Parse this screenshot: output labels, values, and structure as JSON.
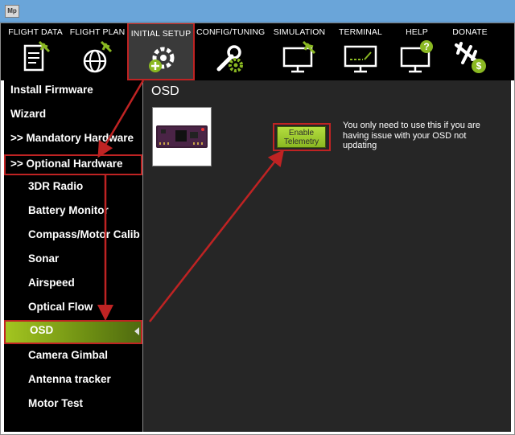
{
  "window": {
    "logo_text": "Mp"
  },
  "menu": [
    {
      "label": "FLIGHT DATA",
      "icon": "flight-data-icon"
    },
    {
      "label": "FLIGHT PLAN",
      "icon": "flight-plan-icon"
    },
    {
      "label": "INITIAL SETUP",
      "icon": "initial-setup-icon",
      "selected": true
    },
    {
      "label": "CONFIG/TUNING",
      "icon": "config-tuning-icon"
    },
    {
      "label": "SIMULATION",
      "icon": "simulation-icon"
    },
    {
      "label": "TERMINAL",
      "icon": "terminal-icon"
    },
    {
      "label": "HELP",
      "icon": "help-icon"
    },
    {
      "label": "DONATE",
      "icon": "donate-icon"
    }
  ],
  "sidebar": {
    "items": [
      {
        "label": "Install Firmware"
      },
      {
        "label": "Wizard"
      },
      {
        "label": ">> Mandatory Hardware"
      },
      {
        "label": ">> Optional Hardware"
      },
      {
        "label": "3DR Radio"
      },
      {
        "label": "Battery Monitor"
      },
      {
        "label": "Compass/Motor Calib"
      },
      {
        "label": "Sonar"
      },
      {
        "label": "Airspeed"
      },
      {
        "label": "Optical Flow"
      },
      {
        "label": "OSD",
        "active": true
      },
      {
        "label": "Camera Gimbal"
      },
      {
        "label": "Antenna tracker"
      },
      {
        "label": "Motor Test"
      }
    ]
  },
  "main": {
    "title": "OSD",
    "enable_telemetry_label": "Enable Telemetry",
    "hint": "You only need to use this if you are having issue with your OSD not updating"
  },
  "colors": {
    "accent_green": "#8ab822",
    "annotation_red": "#bf2323",
    "panel_bg": "#262626",
    "titlebar": "#6aa5d9"
  }
}
